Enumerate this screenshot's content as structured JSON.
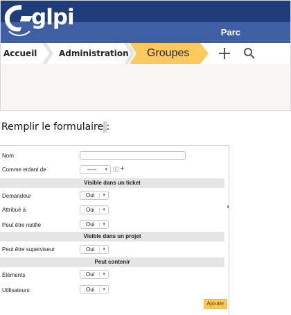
{
  "header": {
    "logo_text": "glpi",
    "section_label": "Parc"
  },
  "breadcrumb": {
    "items": [
      "Accueil",
      "Administration",
      "Groupes"
    ]
  },
  "toolbar": {
    "add_icon": "plus-icon",
    "search_icon": "search-icon"
  },
  "instruction": {
    "text_before": "Remplir le formulaire",
    "text_highlight": " ",
    "text_after": ":"
  },
  "form": {
    "name_label": "Nom",
    "parent_label": "Comme enfant de",
    "parent_value": "-----",
    "sections": {
      "ticket": "Visible dans un ticket",
      "project": "Visible dans un projet",
      "contain": "Peut contenir"
    },
    "requester_label": "Demandeur",
    "requester_value": "Oui",
    "assigned_label": "Attribué à",
    "assigned_value": "Oui",
    "notify_label": "Peut être notifié",
    "notify_value": "Oui",
    "supervisor_label": "Peut être superviseur",
    "supervisor_value": "Oui",
    "elements_label": "Éléments",
    "elements_value": "Oui",
    "users_label": "Utilisateurs",
    "users_value": "Oui",
    "add_button": "Ajouter"
  },
  "colors": {
    "top_band": "#1f3d79",
    "blue_band": "#3e5fa4",
    "active_crumb": "#fec95c",
    "submit_button": "#fec95c"
  }
}
